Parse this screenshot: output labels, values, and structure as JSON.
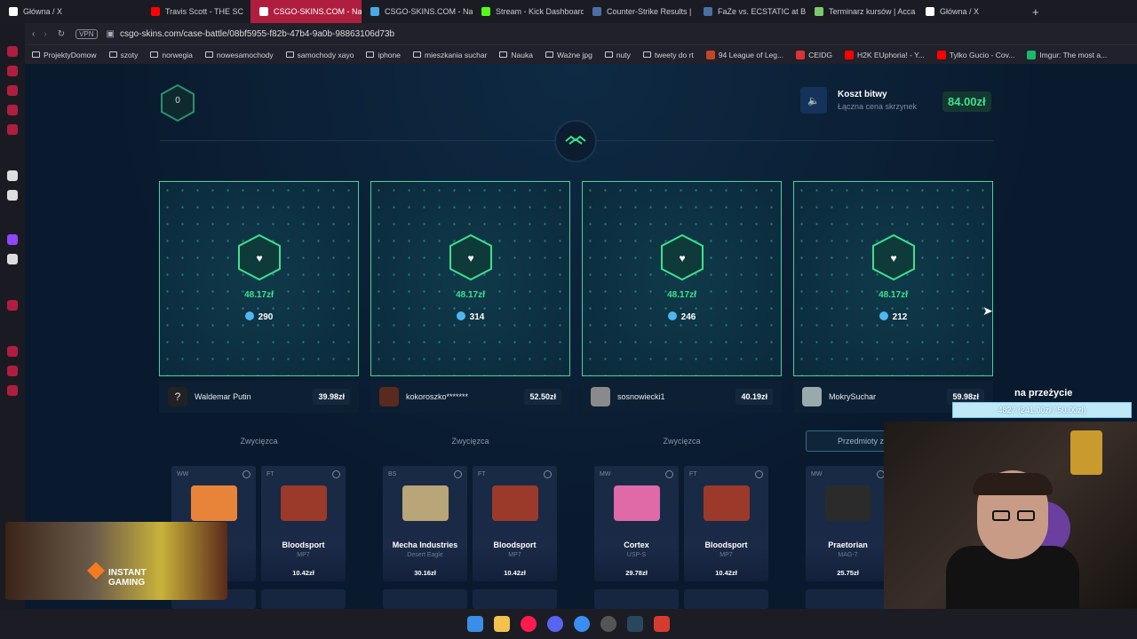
{
  "browser": {
    "tabs": [
      {
        "title": "Główna / X",
        "color": "#ffffff"
      },
      {
        "title": "Travis Scott - THE SC",
        "color": "#ff0000"
      },
      {
        "title": "CSGO-SKINS.COM - Naj",
        "color": "#e0245e",
        "active": true
      },
      {
        "title": "CSGO-SKINS.COM - Naj",
        "color": "#48a9e6"
      },
      {
        "title": "Stream - Kick Dashboard",
        "color": "#53fc18"
      },
      {
        "title": "Counter-Strike Results |",
        "color": "#4a6fa5"
      },
      {
        "title": "FaZe vs. ECSTATIC at BL",
        "color": "#4a6fa5"
      },
      {
        "title": "Terminarz kursów | Acca",
        "color": "#7bc96f"
      },
      {
        "title": "Główna / X",
        "color": "#ffffff"
      }
    ],
    "vpn": "VPN",
    "url": "csgo-skins.com/case-battle/08bf5955-f82b-47b4-9a0b-98863106d73b",
    "bookmarks": [
      "ProjektyDomow",
      "szoty",
      "norwegia",
      "nowesamochody",
      "samochody xayo",
      "iphone",
      "mieszkania suchar",
      "Nauka",
      "Ważne jpg",
      "nuty",
      "tweety do rt",
      "94 League of Leg...",
      "CEIDG",
      "H2K EUphoria! - Y...",
      "Tylko Gucio - Cov...",
      "Imgur: The most a..."
    ]
  },
  "battle": {
    "round": "0",
    "cost_label": "Koszt bitwy",
    "cost_sub": "Łączna cena skrzynek",
    "cost_value": "84.00zł"
  },
  "players": [
    {
      "box_value": "48.17zł",
      "coins": "290",
      "name": "Waldemar Putin",
      "total": "39.98zł",
      "status": "Zwycięzca"
    },
    {
      "box_value": "48.17zł",
      "coins": "314",
      "name": "kokoroszko*******",
      "total": "52.50zł",
      "status": "Zwycięzca"
    },
    {
      "box_value": "48.17zł",
      "coins": "246",
      "name": "sosnowiecki1",
      "total": "40.19zł",
      "status": "Zwycięzca"
    },
    {
      "box_value": "48.17zł",
      "coins": "212",
      "name": "MokrySuchar",
      "total": "59.98zł",
      "status": "Przedmioty z"
    }
  ],
  "items": [
    {
      "quality": "WW",
      "name": "...b",
      "sub": "...N",
      "price": "",
      "gun_color": "#e7843a"
    },
    {
      "quality": "FT",
      "name": "Bloodsport",
      "sub": "MP7",
      "price": "10.42zł",
      "gun_color": "#9b3a2a"
    },
    {
      "quality": "BS",
      "name": "Mecha Industries",
      "sub": "Desert Eagle",
      "price": "30.16zł",
      "gun_color": "#b8a578"
    },
    {
      "quality": "FT",
      "name": "Bloodsport",
      "sub": "MP7",
      "price": "10.42zł",
      "gun_color": "#9b3a2a"
    },
    {
      "quality": "MW",
      "name": "Cortex",
      "sub": "USP-S",
      "price": "29.78zł",
      "gun_color": "#e06aa8"
    },
    {
      "quality": "FT",
      "name": "Bloodsport",
      "sub": "MP7",
      "price": "10.42zł",
      "gun_color": "#9b3a2a"
    },
    {
      "quality": "MW",
      "name": "Praetorian",
      "sub": "MAG-7",
      "price": "25.75zł",
      "gun_color": "#2b2b2b"
    }
  ],
  "overlay": {
    "goal_title": "na przeżycie",
    "goal_progress": "4827 (241.00zł / 50.00zł)",
    "promo": "INSTANT GAMING"
  }
}
